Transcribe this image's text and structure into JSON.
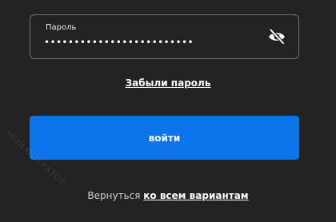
{
  "password_field": {
    "label": "Пароль",
    "masked_value": "•••••••••••••••••••••••••"
  },
  "icons": {
    "visibility_toggle": "eye-off-icon"
  },
  "forgot_password_link": "Забыли пароль",
  "login_button_label": "войти",
  "return": {
    "prefix": "Вернуться",
    "link": "ко всем вариантам"
  },
  "watermark_text": "МОЙ ОПЕРАТОР",
  "colors": {
    "background": "#222222",
    "accent": "#0a74e8",
    "field_border": "#6f6f6f"
  }
}
